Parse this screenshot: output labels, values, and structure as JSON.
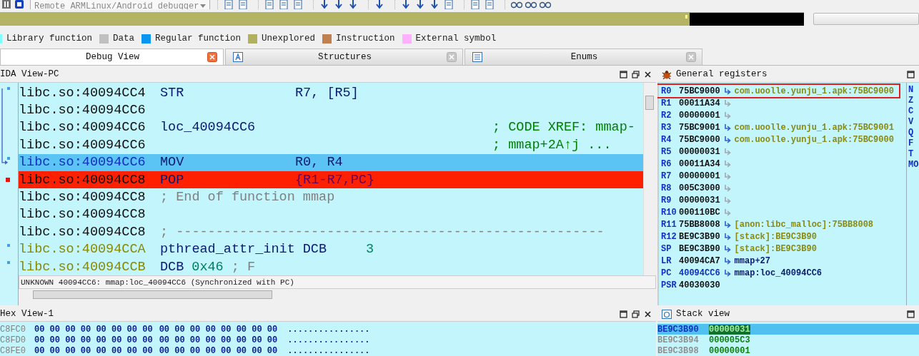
{
  "toolbar": {
    "debugger": "Remote ARMLinux/Android debugger"
  },
  "legend": [
    {
      "label": "Library function",
      "color": "#80ffff"
    },
    {
      "label": "Data",
      "color": "#c0c0c0"
    },
    {
      "label": "Regular function",
      "color": "#0a96f0"
    },
    {
      "label": "Unexplored",
      "color": "#b0b060"
    },
    {
      "label": "Instruction",
      "color": "#c08050"
    },
    {
      "label": "External symbol",
      "color": "#ffb0ff"
    }
  ],
  "tabs": [
    {
      "label": "Debug View",
      "selected": true
    },
    {
      "label": "Structures",
      "selected": false
    },
    {
      "label": "Enums",
      "selected": false
    }
  ],
  "ida_view": {
    "title": "IDA View-PC",
    "lines": [
      {
        "kind": "code",
        "current": false,
        "breakpoint": false,
        "marked": true,
        "flow_arrow": false,
        "address": "libc.so:40094CC4",
        "mnemonic": "STR",
        "operands": "R7, [R5]"
      },
      {
        "kind": "code",
        "current": false,
        "breakpoint": false,
        "marked": false,
        "flow_arrow": false,
        "address": "libc.so:40094CC6"
      },
      {
        "kind": "code",
        "current": false,
        "breakpoint": false,
        "marked": false,
        "flow_arrow": false,
        "address": "libc.so:40094CC6",
        "mnemonic": "loc_40094CC6",
        "comment": "; CODE XREF: mmap-"
      },
      {
        "kind": "code",
        "current": false,
        "breakpoint": false,
        "marked": false,
        "flow_arrow": false,
        "address": "libc.so:40094CC6",
        "comment": "; mmap+2A↑j ..."
      },
      {
        "kind": "code",
        "current": true,
        "breakpoint": false,
        "marked": true,
        "flow_arrow": true,
        "address": "libc.so:40094CC6",
        "mnemonic": "MOV",
        "operands": "R0, R4"
      },
      {
        "kind": "code",
        "current": false,
        "breakpoint": true,
        "marked": false,
        "flow_arrow": false,
        "address": "libc.so:40094CC8",
        "mnemonic": "POP",
        "operands": "{R1-R7,PC}"
      },
      {
        "kind": "note",
        "current": false,
        "breakpoint": false,
        "marked": false,
        "flow_arrow": false,
        "address": "libc.so:40094CC8",
        "comment": "; End of function mmap"
      },
      {
        "kind": "code",
        "current": false,
        "breakpoint": false,
        "marked": false,
        "flow_arrow": false,
        "address": "libc.so:40094CC8"
      },
      {
        "kind": "note",
        "current": false,
        "breakpoint": false,
        "marked": false,
        "flow_arrow": false,
        "address": "libc.so:40094CC8",
        "comment": "; ------------------------------------------------------"
      },
      {
        "kind": "data",
        "current": false,
        "breakpoint": false,
        "marked": true,
        "flow_arrow": false,
        "address": "libc.so:40094CCA",
        "name": "pthread_attr_init",
        "mnemonic": "DCB",
        "operands": "3"
      },
      {
        "kind": "data",
        "current": false,
        "breakpoint": false,
        "marked": true,
        "flow_arrow": false,
        "address": "libc.so:40094CCB",
        "mnemonic": "DCB",
        "operands": "0x46",
        "comment": "; F"
      }
    ],
    "status": "UNKNOWN 40094CC6: mmap:loc_40094CC6 (Synchronized with PC)"
  },
  "registers": {
    "title": "General registers",
    "rows": [
      {
        "name": "R0",
        "value": "75BC9000",
        "arrow": true,
        "target": {
          "text": "com.uoolle.yunju_1.apk:75BC9000",
          "kind": "data"
        },
        "changed": false,
        "annotated": true
      },
      {
        "name": "R1",
        "value": "00011A34",
        "arrow": true,
        "changed": false,
        "annotated": false
      },
      {
        "name": "R2",
        "value": "00000001",
        "arrow": true,
        "changed": false,
        "annotated": false
      },
      {
        "name": "R3",
        "value": "75BC9001",
        "arrow": true,
        "target": {
          "text": "com.uoolle.yunju_1.apk:75BC9001",
          "kind": "data"
        },
        "changed": false,
        "annotated": false
      },
      {
        "name": "R4",
        "value": "75BC9000",
        "arrow": true,
        "target": {
          "text": "com.uoolle.yunju_1.apk:75BC9000",
          "kind": "data"
        },
        "changed": false,
        "annotated": false
      },
      {
        "name": "R5",
        "value": "00000031",
        "arrow": true,
        "changed": false,
        "annotated": false
      },
      {
        "name": "R6",
        "value": "00011A34",
        "arrow": true,
        "changed": false,
        "annotated": false
      },
      {
        "name": "R7",
        "value": "00000001",
        "arrow": true,
        "changed": false,
        "annotated": false
      },
      {
        "name": "R8",
        "value": "005C3000",
        "arrow": true,
        "changed": false,
        "annotated": false
      },
      {
        "name": "R9",
        "value": "00000031",
        "arrow": true,
        "changed": false,
        "annotated": false
      },
      {
        "name": "R10",
        "value": "000110BC",
        "arrow": true,
        "changed": false,
        "annotated": false
      },
      {
        "name": "R11",
        "value": "75BB8008",
        "arrow": true,
        "target": {
          "text": "[anon:libc_malloc]:75BB8008",
          "kind": "data"
        },
        "changed": false,
        "annotated": false
      },
      {
        "name": "R12",
        "value": "BE9C3B90",
        "arrow": true,
        "target": {
          "text": "[stack]:BE9C3B90",
          "kind": "data"
        },
        "changed": false,
        "annotated": false
      },
      {
        "name": "SP",
        "value": "BE9C3B90",
        "arrow": true,
        "target": {
          "text": "[stack]:BE9C3B90",
          "kind": "data"
        },
        "changed": false,
        "annotated": false
      },
      {
        "name": "LR",
        "value": "40094CA7",
        "arrow": true,
        "target": {
          "text": "mmap+27",
          "kind": "code"
        },
        "changed": false,
        "annotated": false
      },
      {
        "name": "PC",
        "value": "40094CC6",
        "arrow": true,
        "target": {
          "text": "mmap:loc_40094CC6",
          "kind": "code"
        },
        "changed": true,
        "annotated": false
      },
      {
        "name": "PSR",
        "value": "40030030",
        "arrow": false,
        "changed": false,
        "annotated": false
      }
    ],
    "flags": [
      "N",
      "Z",
      "C",
      "V",
      "Q",
      "F",
      "T",
      "MO"
    ]
  },
  "hex_view": {
    "title": "Hex View-1",
    "rows": [
      {
        "address": "C8FC0",
        "bytes": [
          "00 00 00 00 00 00 00 00",
          "00 00 00 00 00 00 00 00"
        ],
        "ascii": "................"
      },
      {
        "address": "C8FD0",
        "bytes": [
          "00 00 00 00 00 00 00 00",
          "00 00 00 00 00 00 00 00"
        ],
        "ascii": "................"
      },
      {
        "address": "C8FE0",
        "bytes": [
          "00 00 00 00 00 00 00 00",
          "00 00 00 00 00 00 00 00"
        ],
        "ascii": "................"
      }
    ]
  },
  "stack_view": {
    "title": "Stack view",
    "rows": [
      {
        "address": "BE9C3B90",
        "value": "00000031",
        "selected": true
      },
      {
        "address": "BE9C3B94",
        "value": "000005C3",
        "selected": false
      },
      {
        "address": "BE9C3B98",
        "value": "00000001",
        "selected": false
      }
    ]
  }
}
